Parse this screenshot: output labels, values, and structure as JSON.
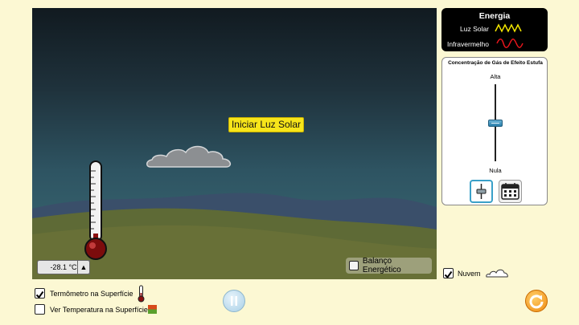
{
  "scene": {
    "start_label": "Iniciar Luz Solar",
    "temperature": "-28.1 °C",
    "unit_toggle": "▲",
    "energy_balance_label": "Balanço Energético",
    "energy_balance_checked": false
  },
  "energy_legend": {
    "title": "Energia",
    "sunlight_label": "Luz Solar",
    "infrared_label": "Infravermelho",
    "sunlight_color": "#f3e600",
    "infrared_color": "#e8161c"
  },
  "greenhouse": {
    "title": "Concentração de Gás de Efeito Estufa",
    "high_label": "Alta",
    "low_label": "Nula",
    "level": 0.5
  },
  "controls": {
    "surface_thermometer_label": "Termômetro na Superfície",
    "surface_thermometer_checked": true,
    "surface_temperature_label": "Ver Temperatura na Superfície",
    "surface_temperature_checked": false,
    "cloud_label": "Nuvem",
    "cloud_checked": true
  },
  "colors": {
    "background": "#fcf8d3",
    "sky_top": "#111a20",
    "ground": "#5e6a36"
  }
}
